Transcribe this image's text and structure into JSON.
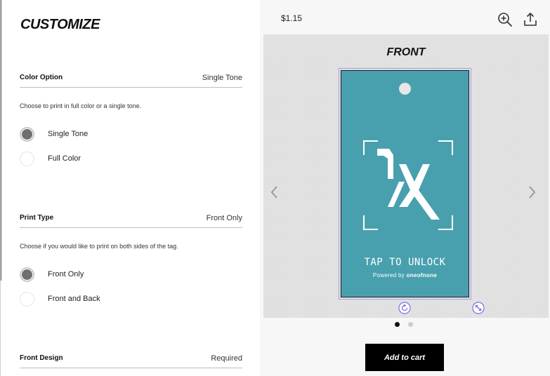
{
  "customize": {
    "title": "CUSTOMIZE",
    "sections": {
      "color": {
        "label": "Color Option",
        "value": "Single Tone",
        "description": "Choose to print in full color or a single tone.",
        "options": [
          {
            "label": "Single Tone",
            "selected": true
          },
          {
            "label": "Full Color",
            "selected": false
          }
        ]
      },
      "print": {
        "label": "Print Type",
        "value": "Front Only",
        "description": "Choose if you would like to print on both sides of the tag.",
        "options": [
          {
            "label": "Front Only",
            "selected": true
          },
          {
            "label": "Front and Back",
            "selected": false
          }
        ]
      },
      "design": {
        "label": "Front Design",
        "value": "Required"
      }
    }
  },
  "preview": {
    "price": "$1.15",
    "side_label": "FRONT",
    "tag": {
      "color": "#48a0ae",
      "cta": "TAP TO UNLOCK",
      "powered_prefix": "Powered by",
      "powered_brand": "oneofnone"
    },
    "pager": {
      "current": 1,
      "total": 2
    },
    "add_to_cart": "Add to cart",
    "icons": [
      "zoom-in-icon",
      "share-icon",
      "chevron-left-icon",
      "chevron-right-icon",
      "rotate-icon",
      "resize-icon"
    ]
  },
  "colors": {
    "accent": "#7b6ee6",
    "tag_teal": "#48a0ae",
    "button": "#000000"
  }
}
